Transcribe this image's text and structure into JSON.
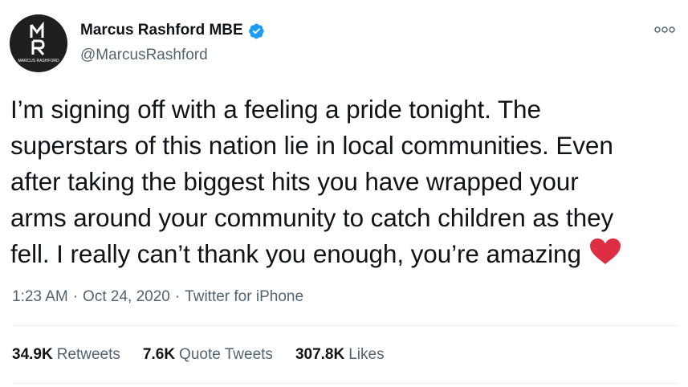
{
  "user": {
    "display_name": "Marcus Rashford MBE",
    "handle": "@MarcusRashford",
    "verified": true,
    "avatar_monogram": "MR",
    "avatar_caption": "MARCUS RASHFORD"
  },
  "tweet": {
    "lines": [
      "I’m signing off with a feeling a pride tonight. The",
      "superstars of this nation lie in local communities. Even",
      "after taking the biggest hits you have wrapped your",
      "arms around your community to catch children as they",
      "fell. I really can’t thank you enough, you’re amazing"
    ],
    "emoji": "heart-icon"
  },
  "meta": {
    "time": "1:23 AM",
    "date": "Oct 24, 2020",
    "source": "Twitter for iPhone",
    "separator": "·"
  },
  "stats": [
    {
      "count": "34.9K",
      "label": "Retweets"
    },
    {
      "count": "7.6K",
      "label": "Quote Tweets"
    },
    {
      "count": "307.8K",
      "label": "Likes"
    }
  ],
  "colors": {
    "text": "#0f1419",
    "secondary": "#536471",
    "verified": "#1d9bf0",
    "heart": "#dd2e44",
    "divider": "#eff3f4"
  }
}
